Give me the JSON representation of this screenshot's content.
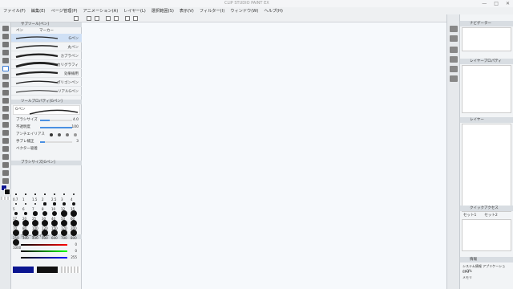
{
  "window": {
    "title": "CLIP STUDIO PAINT EX",
    "minimize": "—",
    "maximize": "□",
    "close": "✕"
  },
  "menu": [
    "ファイル(F)",
    "編集(E)",
    "ページ管理(P)",
    "アニメーション(A)",
    "レイヤー(L)",
    "選択範囲(S)",
    "表示(V)",
    "フィルター(I)",
    "ウィンドウ(W)",
    "ヘルプ(H)"
  ],
  "left_panel": {
    "subtool_header": "サブツール[ペン]",
    "subtool_tabs": [
      "ペン",
      "マーカー"
    ],
    "brushes": [
      "Gペン",
      "丸ペン",
      "カブラペン",
      "カリグラフィ",
      "効果線用",
      "ポリゴンペン",
      "リアルGペン"
    ],
    "tool_property_header": "ツールプロパティ[Gペン]",
    "tool_property_name": "Gペン",
    "props": [
      {
        "label": "ブラシサイズ",
        "value": "4.0"
      },
      {
        "label": "不透明度",
        "value": "100"
      },
      {
        "label": "アンチエイリアス",
        "value": ""
      },
      {
        "label": "手ブレ補正",
        "value": "3"
      },
      {
        "label": "ベクター吸着",
        "value": ""
      }
    ],
    "brushsize_header": "ブラシサイズ[Gペン]",
    "sizes": [
      "0.7",
      "1",
      "1.5",
      "2",
      "2.5",
      "3",
      "4",
      "5",
      "6",
      "7",
      "8",
      "10",
      "12",
      "15",
      "17",
      "20",
      "25",
      "30",
      "40",
      "50",
      "60",
      "70",
      "80",
      "100",
      "120",
      "150",
      "170",
      "200",
      "250",
      "300",
      "400",
      "500",
      "600",
      "700",
      "800",
      "1000"
    ],
    "color_slider_header": "カラースライダー",
    "color_values": [
      "0",
      "0",
      "255"
    ]
  },
  "right_panel": {
    "navigator_header": "ナビゲーター",
    "layer_property_header": "レイヤープロパティ",
    "layer_header": "レイヤー",
    "quick_access_header": "クイックアクセス",
    "quick_tabs": [
      "セット1",
      "セット2"
    ],
    "info_header": "情報",
    "info_line": "システム情報  アプリケーション:3%",
    "info_rows": [
      "CPU",
      "メモリ"
    ]
  },
  "colors": {
    "main": "#0b1590",
    "sub": "#111111",
    "accent": "#3a7bd5"
  }
}
